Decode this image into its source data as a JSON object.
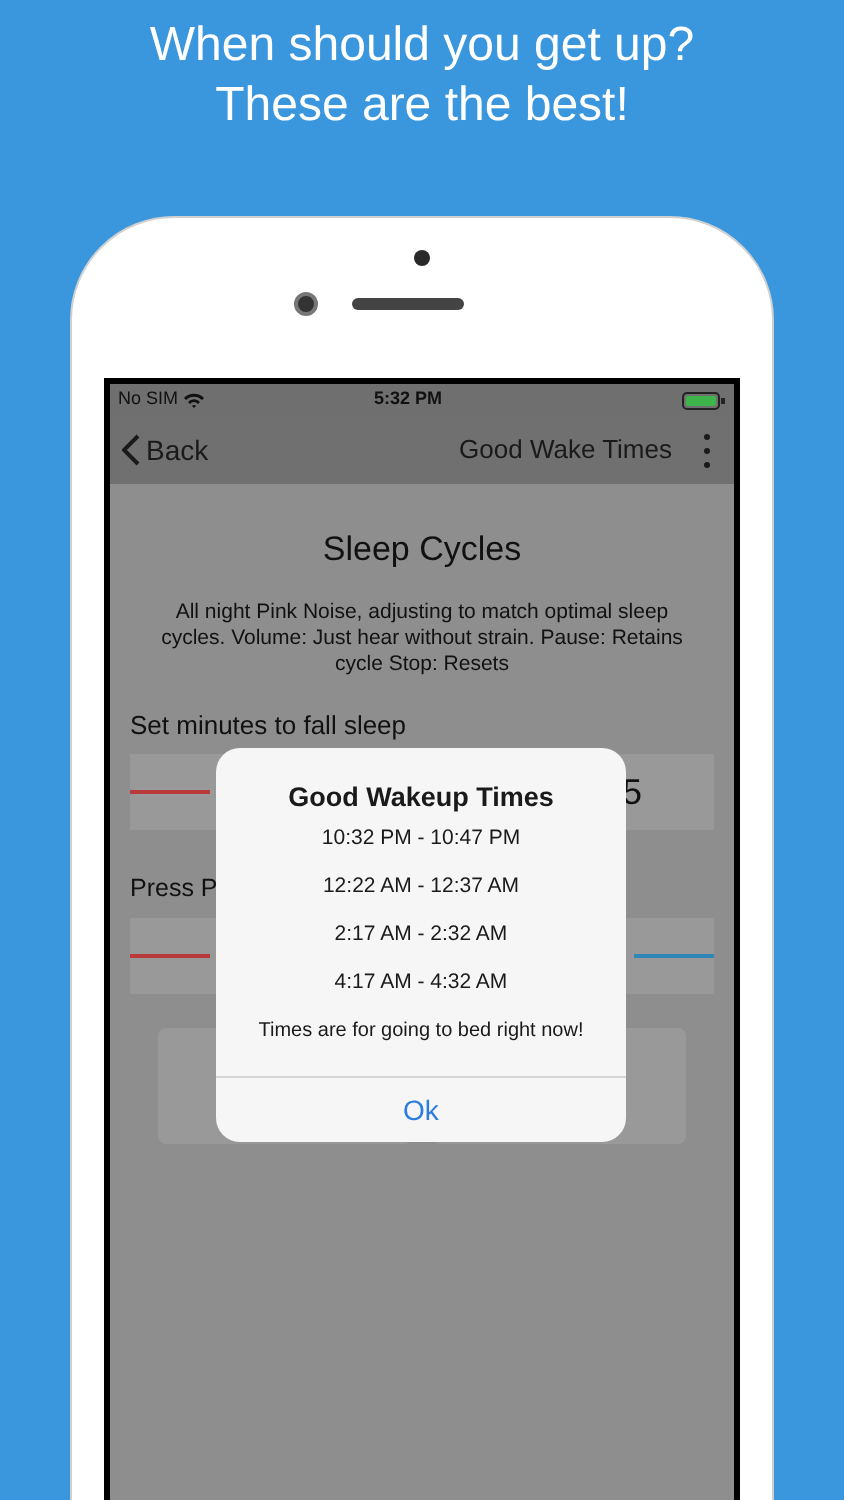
{
  "headline": [
    "When should you get up?",
    "These are the best!"
  ],
  "status_bar": {
    "carrier": "No SIM",
    "time": "5:32 PM"
  },
  "nav": {
    "back": "Back",
    "title": "Good Wake Times"
  },
  "screen": {
    "title": "Sleep Cycles",
    "description": "All night Pink Noise, adjusting to match optimal sleep cycles. Volume: Just hear without strain. Pause: Retains cycle Stop: Resets",
    "sections": [
      {
        "kind": "minutes",
        "label": "Set minutes to fall sleep",
        "value": "5"
      },
      {
        "kind": "volume",
        "label": "Press P"
      }
    ]
  },
  "dialog": {
    "title": "Good Wakeup Times",
    "times": [
      "10:32 PM - 10:47 PM",
      "12:22 AM - 12:37 AM",
      "2:17 AM - 2:32 AM",
      "4:17 AM - 4:32 AM"
    ],
    "note": "Times are for going to bed right now!",
    "button": "Ok"
  }
}
